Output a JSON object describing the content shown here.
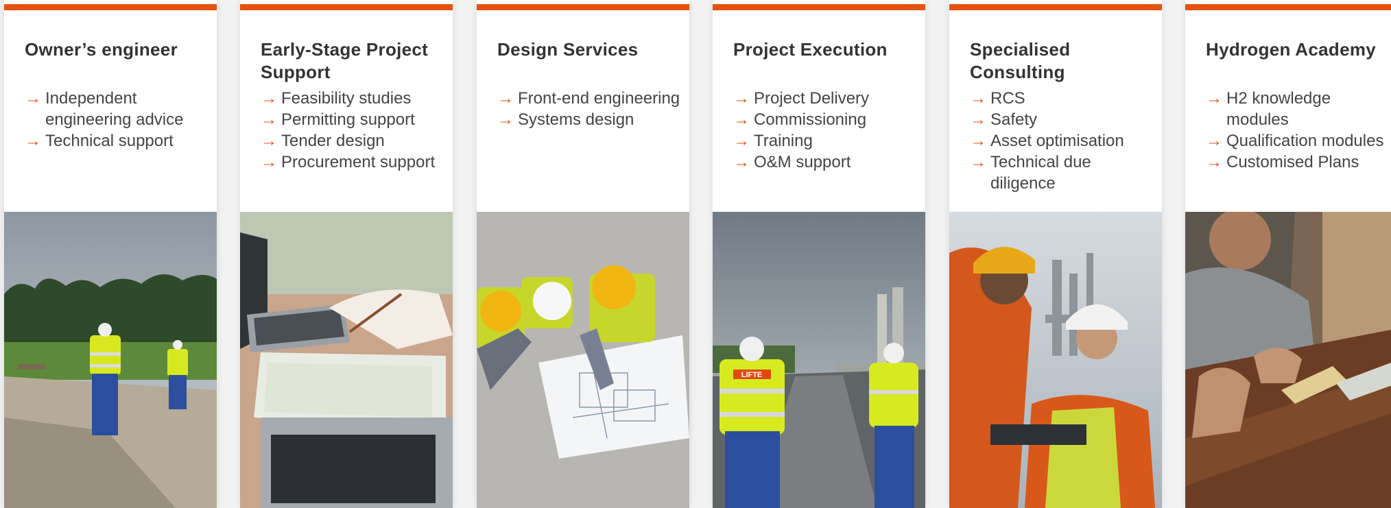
{
  "accent_color": "#e5530f",
  "cards": [
    {
      "title": "Owner’s engineer",
      "items": [
        "Independent engineering advice",
        "Technical support"
      ],
      "image": "engineers-walking-on-site-photo"
    },
    {
      "title": "Early-Stage Project Support",
      "items": [
        "Feasibility studies",
        "Permitting support",
        "Tender design",
        "Procurement support"
      ],
      "image": "laptop-and-notes-photo"
    },
    {
      "title": "Design Services",
      "items": [
        "Front-end engineering",
        "Systems design"
      ],
      "image": "engineers-reviewing-blueprints-photo"
    },
    {
      "title": "Project Execution",
      "items": [
        "Project Delivery",
        "Commissioning",
        "Training",
        "O&M support"
      ],
      "image": "workers-walking-to-plant-photo",
      "vest_text": "LIFTE"
    },
    {
      "title": "Specialised Consulting",
      "items": [
        "RCS",
        "Safety",
        "Asset optimisation",
        "Technical due diligence"
      ],
      "image": "engineers-at-refinery-photo"
    },
    {
      "title": "Hydrogen Academy",
      "items": [
        "H2 knowledge modules",
        "Qualification modules",
        "Customised Plans"
      ],
      "image": "people-studying-at-table-photo"
    }
  ]
}
